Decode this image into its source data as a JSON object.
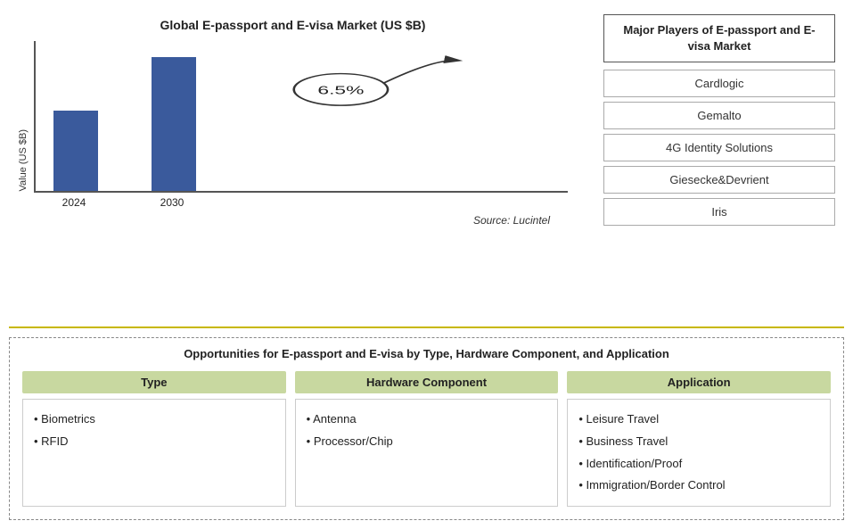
{
  "chart": {
    "title": "Global E-passport and E-visa Market (US $B)",
    "y_axis_label": "Value (US $B)",
    "bars": [
      {
        "year": "2024",
        "height_pct": 60
      },
      {
        "year": "2030",
        "height_pct": 100
      }
    ],
    "annotation": "6.5%",
    "source": "Source: Lucintel"
  },
  "players": {
    "title": "Major Players of E-passport and E-visa Market",
    "items": [
      "Cardlogic",
      "Gemalto",
      "4G Identity Solutions",
      "Giesecke&Devrient",
      "Iris"
    ]
  },
  "bottom": {
    "title": "Opportunities for E-passport and E-visa by Type, Hardware Component, and Application",
    "columns": [
      {
        "header": "Type",
        "items": [
          "Biometrics",
          "RFID"
        ]
      },
      {
        "header": "Hardware Component",
        "items": [
          "Antenna",
          "Processor/Chip"
        ]
      },
      {
        "header": "Application",
        "items": [
          "Leisure Travel",
          "Business Travel",
          "Identification/Proof",
          "Immigration/Border Control"
        ]
      }
    ]
  }
}
